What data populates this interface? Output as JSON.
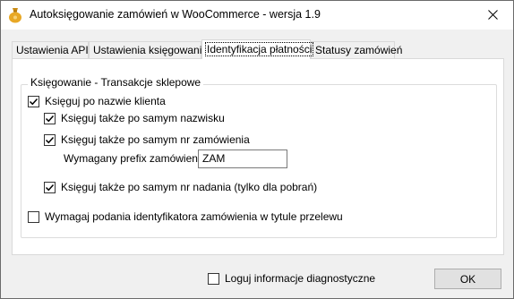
{
  "window": {
    "title": "Autoksięgowanie zamówień w WooCommerce - wersja 1.9",
    "app_icon": "bag-icon",
    "close_icon": "close-icon"
  },
  "tabs": [
    {
      "label": "Ustawienia API",
      "active": false
    },
    {
      "label": "Ustawienia księgowania",
      "active": false
    },
    {
      "label": "Identyfikacja płatności",
      "active": true
    },
    {
      "label": "Statusy zamówień",
      "active": false
    }
  ],
  "group": {
    "title": "Księgowanie - Transakcje sklepowe",
    "options": {
      "by_customer_name": {
        "label": "Księguj po nazwie klienta",
        "checked": true
      },
      "by_surname": {
        "label": "Księguj także po samym nazwisku",
        "checked": true
      },
      "by_order_number": {
        "label": "Księguj także po samym nr zamówienia",
        "checked": true
      },
      "prefix_label": "Wymagany prefix zamówienia:",
      "prefix_value": "ZAM",
      "by_shipment_number": {
        "label": "Księguj także po samym nr nadania (tylko dla pobrań)",
        "checked": true
      },
      "require_order_id": {
        "label": "Wymagaj podania identyfikatora zamówienia w tytule przelewu",
        "checked": false
      }
    }
  },
  "footer": {
    "log_label": "Loguj informacje diagnostyczne",
    "log_checked": false,
    "ok_label": "OK"
  },
  "colors": {
    "window_bg": "#f0f0f0",
    "panel_bg": "#ffffff",
    "button_bg": "#e1e1e1",
    "app_icon_color": "#e8a826"
  }
}
